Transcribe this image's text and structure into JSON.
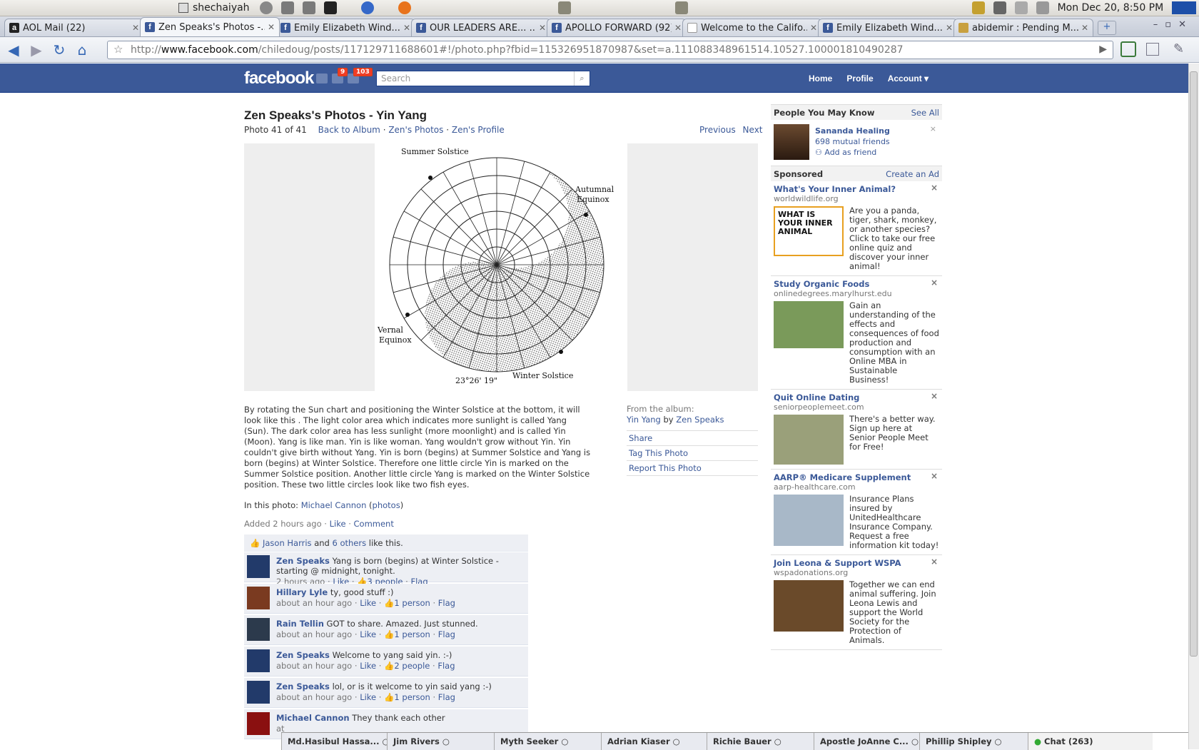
{
  "system": {
    "user": "shechaiyah",
    "clock": "Mon Dec 20,  8:50 PM"
  },
  "browser": {
    "tabs": [
      {
        "title": "AOL Mail (22)",
        "fav": "aol-icon"
      },
      {
        "title": "Zen Speaks's Photos -...",
        "fav": "f",
        "active": true
      },
      {
        "title": "Emily Elizabeth Wind...",
        "fav": "f"
      },
      {
        "title": "OUR LEADERS ARE... ...",
        "fav": "f"
      },
      {
        "title": "APOLLO FORWARD (92)",
        "fav": "f"
      },
      {
        "title": "Welcome to the Califo...",
        "fav": "page-icon"
      },
      {
        "title": "Emily Elizabeth Wind...",
        "fav": "f"
      },
      {
        "title": "abidemir : Pending M...",
        "fav": "user-icon"
      }
    ],
    "url_prefix": "http://",
    "url_domain": "www.facebook.com",
    "url_rest": "/chiledoug/posts/117129711688601#!/photo.php?fbid=115326951870987&set=a.111088348961514.10527.100001810490287"
  },
  "fb": {
    "logo": "facebook",
    "notif_badge_1": "9",
    "notif_badge_2": "103",
    "search_placeholder": "Search",
    "nav": [
      "Home",
      "Profile",
      "Account ▾"
    ]
  },
  "photo_page": {
    "title": "Zen Speaks's Photos - Yin Yang",
    "count": "Photo 41 of 41",
    "links": [
      "Back to Album",
      "Zen's Photos",
      "Zen's Profile"
    ],
    "previous": "Previous",
    "next": "Next",
    "image_labels": {
      "summer": "Summer Solstice",
      "autumnal1": "Autumnal",
      "autumnal2": "Equinox",
      "vernal1": "Vernal",
      "vernal2": "Equinox",
      "winter": "Winter Solstice",
      "angle": "23°26' 19\""
    },
    "caption": "By rotating the Sun chart and positioning the Winter Solstice at the bottom, it will look like this . The light color area which indicates more sunlight is called Yang (Sun). The dark color area has less sunlight (more moonlight) and is called Yin (Moon). Yang is like man. Yin is like woman. Yang wouldn't grow without Yin. Yin couldn't give birth without Yang. Yin is born (begins) at Summer Solstice and Yang is born (begins) at Winter Solstice. Therefore one little circle Yin is marked on the Summer Solstice position. Another little circle Yang is marked on the Winter Solstice position. These two little circles look like two fish eyes.",
    "in_photo_label": "In this photo:",
    "in_photo_name": "Michael Cannon",
    "in_photo_photos": "photos",
    "added": "Added 2 hours ago",
    "like": "Like",
    "comment": "Comment",
    "likes_name": "Jason Harris",
    "likes_and": "and",
    "likes_others": "6 others",
    "likes_tail": "like this.",
    "album_from": "From the album:",
    "album_name": "Yin Yang",
    "album_by": "by",
    "album_owner": "Zen Speaks",
    "actions": [
      "Share",
      "Tag This Photo",
      "Report This Photo"
    ]
  },
  "comments": [
    {
      "name": "Zen Speaks",
      "text": "Yang is born (begins) at Winter Solstice - starting @ midnight, tonight.",
      "time": "2 hours ago",
      "like": "Like",
      "count": "3 people",
      "flag": "Flag"
    },
    {
      "name": "Hillary Lyle",
      "text": "ty, good stuff :)",
      "time": "about an hour ago",
      "like": "Like",
      "count": "1 person",
      "flag": "Flag"
    },
    {
      "name": "Rain Tellin",
      "text": "GOT to share. Amazed. Just stunned.",
      "time": "about an hour ago",
      "like": "Like",
      "count": "1 person",
      "flag": "Flag"
    },
    {
      "name": "Zen Speaks",
      "text": "Welcome to yang said yin. :-)",
      "time": "about an hour ago",
      "like": "Like",
      "count": "2 people",
      "flag": "Flag"
    },
    {
      "name": "Zen Speaks",
      "text": "lol, or is it welcome to yin said yang :-)",
      "time": "about an hour ago",
      "like": "Like",
      "count": "1 person",
      "flag": "Flag"
    },
    {
      "name": "Michael Cannon",
      "text": "They thank each other",
      "time": "at",
      "like": "",
      "count": "",
      "flag": ""
    }
  ],
  "sidebar": {
    "pymk_title": "People You May Know",
    "see_all": "See All",
    "pymk_name": "Sananda Healing",
    "pymk_mutual": "698 mutual friends",
    "pymk_add": "Add as friend",
    "sponsored": "Sponsored",
    "create_ad": "Create an Ad",
    "ads": [
      {
        "title": "What's Your Inner Animal?",
        "url": "worldwildlife.org",
        "text": "Are you a panda, tiger, shark, monkey, or another species? Click to take our free online quiz and discover your inner animal!",
        "thumb": "WHAT IS YOUR INNER ANIMAL"
      },
      {
        "title": "Study Organic Foods",
        "url": "onlinedegrees.marylhurst.edu",
        "text": "Gain an understanding of the effects and consequences of food production and consumption with an Online MBA in Sustainable Business!"
      },
      {
        "title": "Quit Online Dating",
        "url": "seniorpeoplemeet.com",
        "text": "There's a better way. Sign up here at Senior People Meet for Free!"
      },
      {
        "title": "AARP® Medicare Supplement",
        "url": "aarp-healthcare.com",
        "text": "Insurance Plans insured by UnitedHealthcare Insurance Company. Request a free information kit today!"
      },
      {
        "title": "Join Leona & Support WSPA",
        "url": "wspadonations.org",
        "text": "Together we can end animal suffering. Join Leona Lewis and support the World Society for the Protection of Animals."
      }
    ]
  },
  "chat": {
    "friends": [
      "Md.Hasibul Hassa...",
      "Jim Rivers",
      "Myth Seeker",
      "Adrian Kiaser",
      "Richie Bauer",
      "Apostle JoAnne C...",
      "Phillip Shipley"
    ],
    "main": "Chat (263)"
  }
}
